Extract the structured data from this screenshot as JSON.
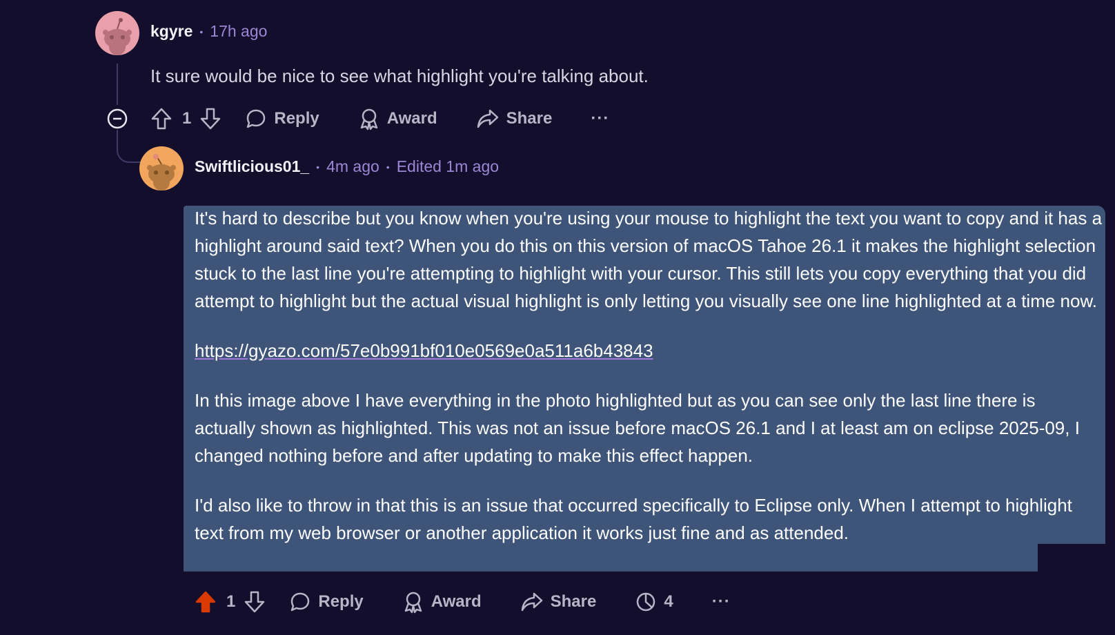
{
  "comment1": {
    "username": "kgyre",
    "time": "17h ago",
    "body": "It sure would be nice to see what highlight you're talking about.",
    "score": "1",
    "reply_label": "Reply",
    "award_label": "Award",
    "share_label": "Share",
    "more_label": "···"
  },
  "comment2": {
    "username": "Swiftlicious01_",
    "time": "4m ago",
    "edited": "Edited 1m ago",
    "para1": "It's hard to describe but you know when you're using your mouse to highlight the text you want to copy and it has a highlight around said text? When you do this on this version of macOS Tahoe 26.1 it makes the highlight selection stuck to the last line you're attempting to highlight with your cursor. This still lets you copy everything that you did attempt to highlight but the actual visual highlight is only letting you visually see one line highlighted at a time now.",
    "link": "https://gyazo.com/57e0b991bf010e0569e0a511a6b43843",
    "para3": "In this image above I have everything in the photo highlighted but as you can see only the last line there is actually shown as highlighted. This was not an issue before macOS 26.1 and I at least am on eclipse 2025-09, I changed nothing before and after updating to make this effect happen.",
    "para4": "I'd also like to throw in that this is an issue that occurred specifically to Eclipse only. When I attempt to highlight text from my web browser or another application it works just fine and as attended.",
    "score": "1",
    "reply_label": "Reply",
    "award_label": "Award",
    "share_label": "Share",
    "views": "4",
    "more_label": "···"
  },
  "colors": {
    "background": "#120e2b",
    "selection": "#3e5478",
    "upvote_active": "#d93a00",
    "meta": "#9b87d6"
  }
}
